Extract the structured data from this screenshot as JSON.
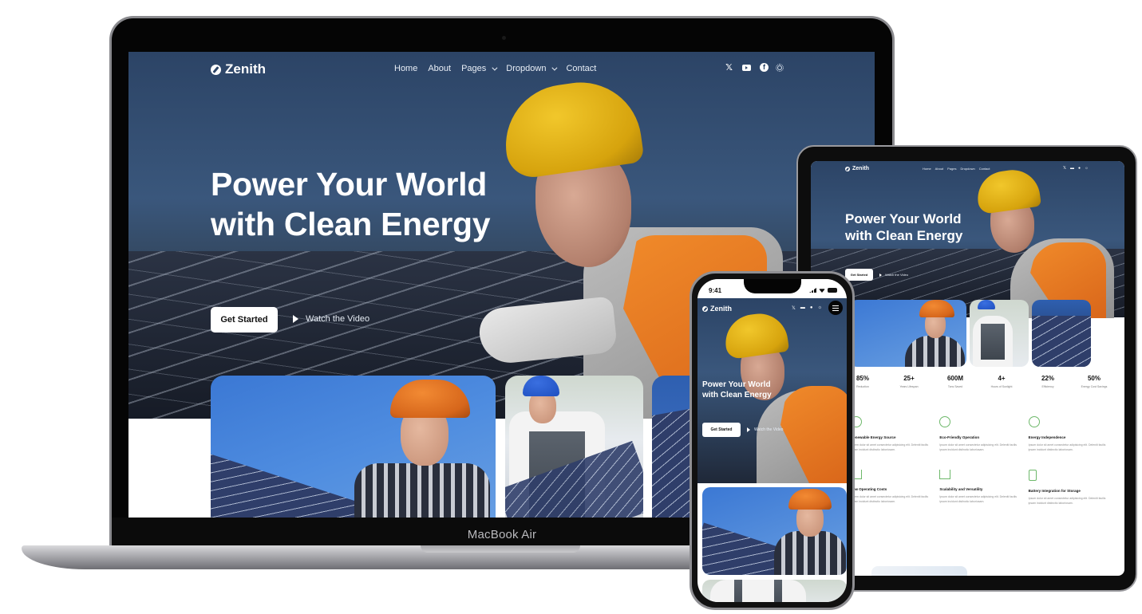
{
  "site": {
    "brand": "Zenith",
    "nav": [
      {
        "label": "Home",
        "has_dropdown": false
      },
      {
        "label": "About",
        "has_dropdown": false
      },
      {
        "label": "Pages",
        "has_dropdown": true
      },
      {
        "label": "Dropdown",
        "has_dropdown": true
      },
      {
        "label": "Contact",
        "has_dropdown": false
      }
    ],
    "socials": [
      "x-icon",
      "youtube-icon",
      "facebook-icon",
      "theme-toggle-icon"
    ],
    "social_glyphs": {
      "x": "𝕏",
      "facebook": "f"
    },
    "hero": {
      "title": "Power Your World with Clean Energy",
      "cta_primary": "Get Started",
      "cta_secondary": "Watch the Video"
    },
    "stats": [
      {
        "value": "85%",
        "label": "Reduction"
      },
      {
        "value": "25+",
        "label": "Years Lifespan"
      },
      {
        "value": "600M",
        "label": "Tons Saved"
      },
      {
        "value": "4+",
        "label": "Hours of Sunlight"
      },
      {
        "value": "22%",
        "label": "Efficiency"
      },
      {
        "value": "50%",
        "label": "Energy Cost Savings"
      }
    ],
    "features": [
      {
        "title": "Renewable Energy Source",
        "icon": "leaf-icon",
        "text": "Lorem dolor sit amet consectetur adipisicing elit. Deleniti facilis ipsam incidunt distinctio laboriosam."
      },
      {
        "title": "Eco-Friendly Operation",
        "icon": "globe-icon",
        "text": "Ipsum dolor sit amet consectetur adipisicing elit. Deleniti facilis ipsam incidunt distinctio laboriosam."
      },
      {
        "title": "Energy Independence",
        "icon": "energy-cycle-icon",
        "text": "Ipsum dolor sit amet consectetur adipisicing elit. Deleniti facilis ipsam incidunt distinctio laboriosam."
      },
      {
        "title": "Low Operating Costs",
        "icon": "house-icon",
        "text": "Lorem dolor sit amet consectetur adipisicing elit. Deleniti facilis ipsam incidunt distinctio laboriosam."
      },
      {
        "title": "Scalability and Versatility",
        "icon": "wind-turbine-icon",
        "text": "Ipsum dolor sit amet consectetur adipisicing elit. Deleniti facilis ipsam incidunt distinctio laboriosam."
      },
      {
        "title": "Battery Integration for Storage",
        "icon": "battery-icon",
        "text": "Ipsum dolor sit amet consectetur adipisicing elit. Deleniti facilis ipsam incidunt distinctio laboriosam."
      }
    ]
  },
  "devices": {
    "laptop_label": "MacBook Air",
    "phone_time": "9:41"
  },
  "colors": {
    "hero_blue": "#2c4466",
    "accent_green": "#6db86a",
    "text_dark": "#111111"
  }
}
